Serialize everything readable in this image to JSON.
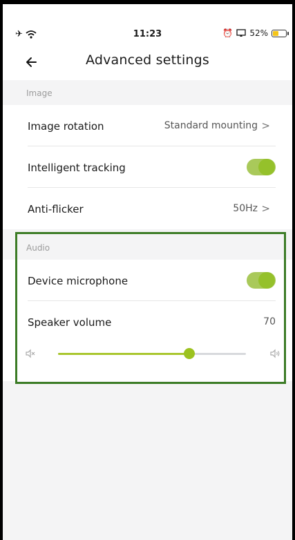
{
  "status_bar": {
    "time": "11:23",
    "battery_percent_text": "52%",
    "battery_level": 0.52
  },
  "header": {
    "title": "Advanced settings"
  },
  "sections": {
    "image": {
      "label": "Image",
      "image_rotation": {
        "label": "Image rotation",
        "value": "Standard mounting"
      },
      "intelligent_tracking": {
        "label": "Intelligent tracking",
        "enabled": true
      },
      "anti_flicker": {
        "label": "Anti-flicker",
        "value": "50Hz"
      }
    },
    "audio": {
      "label": "Audio",
      "device_microphone": {
        "label": "Device microphone",
        "enabled": true
      },
      "speaker_volume": {
        "label": "Speaker volume",
        "value": "70",
        "level": 0.7
      }
    }
  },
  "colors": {
    "accent": "#9cc21f",
    "highlight_border": "#3b7b25",
    "battery": "#f5c518"
  },
  "icons": {
    "airplane": "airplane-icon",
    "wifi": "wifi-icon",
    "alarm": "alarm-icon",
    "screen_mirror": "screen-mirror-icon",
    "back": "back-arrow-icon",
    "chevron": "chevron-right-icon",
    "mute": "speaker-mute-icon",
    "volume": "speaker-volume-icon"
  }
}
